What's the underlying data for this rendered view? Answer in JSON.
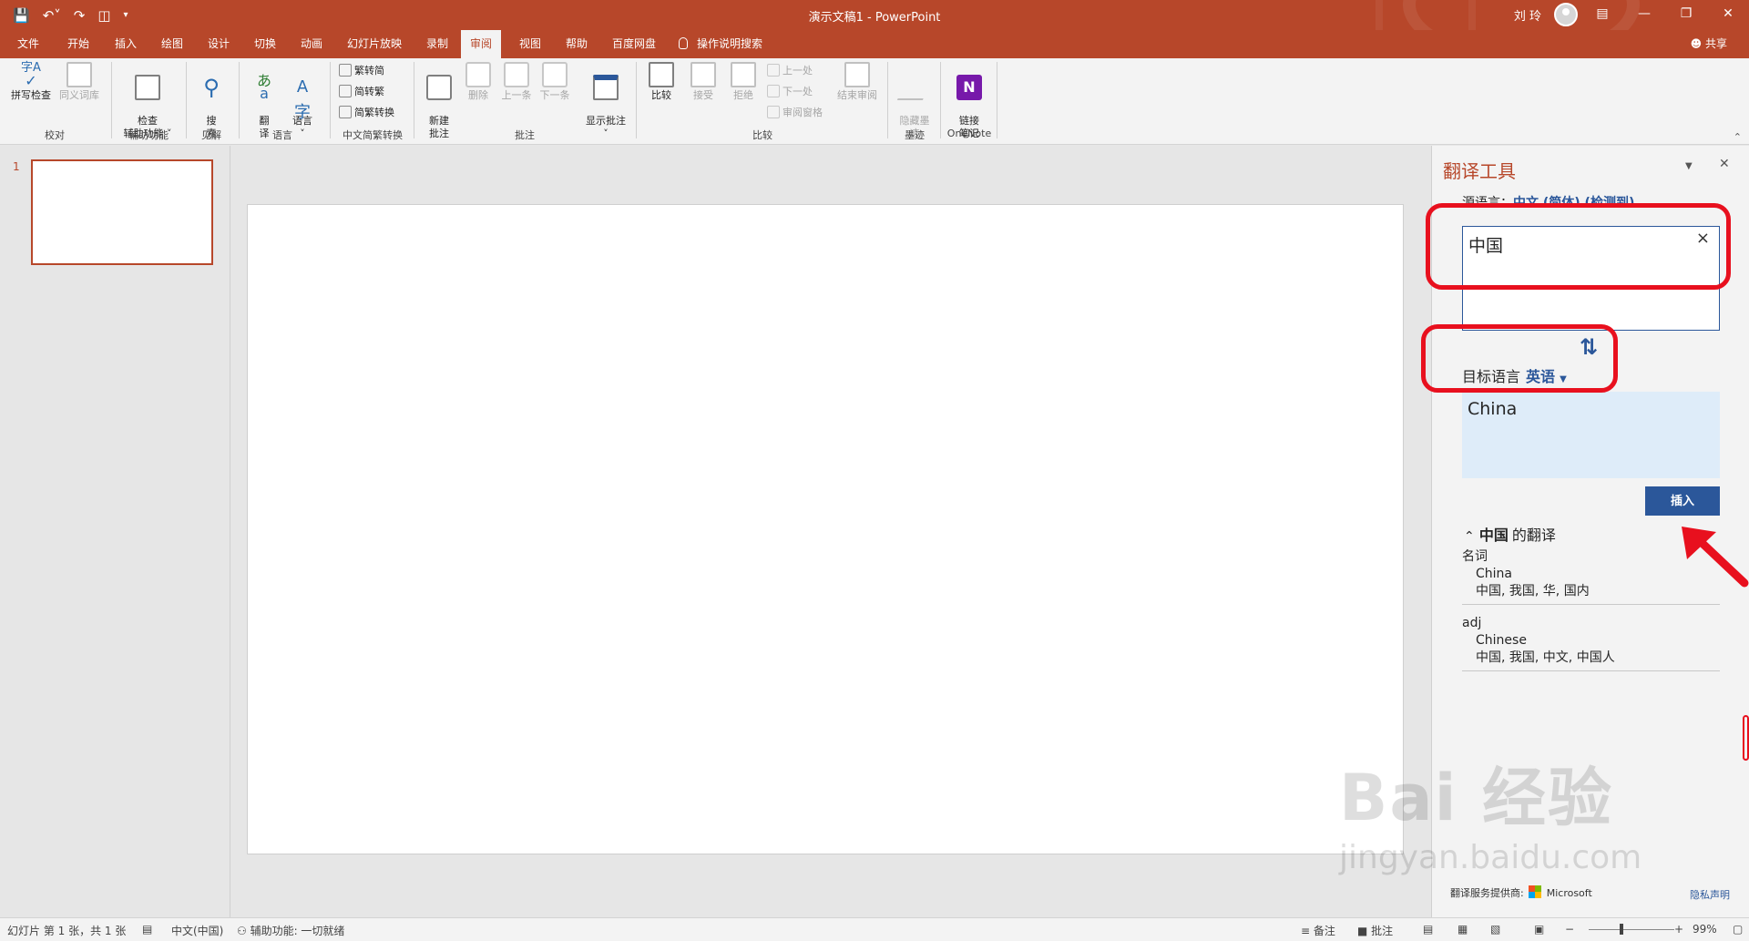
{
  "titlebar": {
    "doc_title": "演示文稿1  -  PowerPoint",
    "user": "刘 玲",
    "qat": [
      "save-icon",
      "undo-icon",
      "redo-icon",
      "present-from-start-icon",
      "customize-qat-icon"
    ]
  },
  "menu": {
    "tabs": [
      "文件",
      "开始",
      "插入",
      "绘图",
      "设计",
      "切换",
      "动画",
      "幻灯片放映",
      "录制",
      "审阅",
      "视图",
      "帮助",
      "百度网盘"
    ],
    "active_tab": "审阅",
    "tell_me": "操作说明搜索",
    "share": "共享"
  },
  "ribbon": {
    "proofing": {
      "spell": "拼写检查",
      "thesaurus": "同义词库",
      "label": "校对"
    },
    "accessibility": {
      "check": "检查\n辅助功能 ˅",
      "label": "辅助功能"
    },
    "insights": {
      "search": "搜\n索",
      "label": "见解"
    },
    "language": {
      "translate": "翻\n译",
      "language": "语言\n˅",
      "label": "语言"
    },
    "chinese_conv": {
      "t2s": "繁转简",
      "s2t": "简转繁",
      "conv": "简繁转换",
      "label": "中文简繁转换"
    },
    "comments": {
      "new": "新建\n批注",
      "delete": "删除",
      "prev": "上一条",
      "next": "下一条",
      "show": "显示批注\n˅",
      "label": "批注"
    },
    "compare": {
      "compare": "比较",
      "accept": "接受",
      "reject": "拒绝",
      "prev": "上一处",
      "next": "下一处",
      "pane": "审阅窗格",
      "end": "结束审阅",
      "label": "比较"
    },
    "ink": {
      "hide": "隐藏墨\n迹",
      "label": "墨迹"
    },
    "onenote": {
      "link": "链接\n笔记",
      "label": "OneNote"
    }
  },
  "slides": {
    "number": "1"
  },
  "translator": {
    "title": "翻译工具",
    "source_label": "源语言",
    "source_lang": "中文 (简体) (检测到)",
    "source_text": "中国",
    "target_label": "目标语言",
    "target_lang": "英语",
    "target_text": "China",
    "insert": "插入",
    "dict_word": "中国",
    "dict_suffix": "的翻译",
    "entries": [
      {
        "pos": "名词",
        "word": "China",
        "senses": "中国, 我国, 华, 国内"
      },
      {
        "pos": "adj",
        "word": "Chinese",
        "senses": "中国, 我国, 中文, 中国人"
      }
    ],
    "provider": "翻译服务提供商:",
    "provider_name": "Microsoft",
    "privacy": "隐私声明"
  },
  "status": {
    "slide_info": "幻灯片 第 1 张，共 1 张",
    "language": "中文(中国)",
    "accessibility": "辅助功能: 一切就绪",
    "notes": "备注",
    "comments": "批注",
    "zoom": "99%"
  },
  "watermark": {
    "main": "Bai 经验",
    "sub": "jingyan.baidu.com"
  },
  "colors": {
    "accent": "#b7472a",
    "link": "#2b579a",
    "highlight": "#e8101e"
  }
}
